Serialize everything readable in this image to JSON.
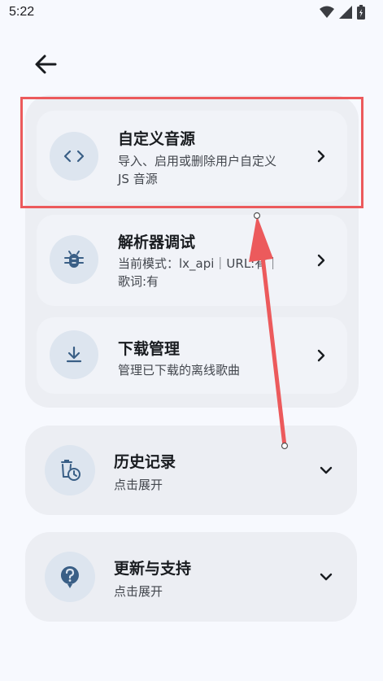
{
  "status_bar": {
    "time": "5:22",
    "icons": [
      "wifi-icon",
      "cellular-icon",
      "battery-icon"
    ]
  },
  "nav": {
    "back_icon": "arrow-back-icon"
  },
  "group": {
    "items": [
      {
        "title": "自定义音源",
        "desc_line1": "导入、启用或删除用户自定义",
        "desc_line2": "JS 音源",
        "icon": "code-icon"
      },
      {
        "title": "解析器调试",
        "desc_line1": "当前模式：lx_api｜URL:有｜",
        "desc_line2": "歌词:有",
        "icon": "bug-icon"
      },
      {
        "title": "下载管理",
        "desc_line1": "管理已下载的离线歌曲",
        "icon": "download-icon"
      }
    ]
  },
  "cards": [
    {
      "title": "历史记录",
      "desc": "点击展开",
      "icon": "history-delete-icon"
    },
    {
      "title": "更新与支持",
      "desc": "点击展开",
      "icon": "help-icon"
    }
  ],
  "colors": {
    "background": "#f7f9fe",
    "surface": "#eceef3",
    "icon_bg": "#dde5ef",
    "icon_fg": "#3a5f86",
    "annotation": "#ec5a5c"
  }
}
